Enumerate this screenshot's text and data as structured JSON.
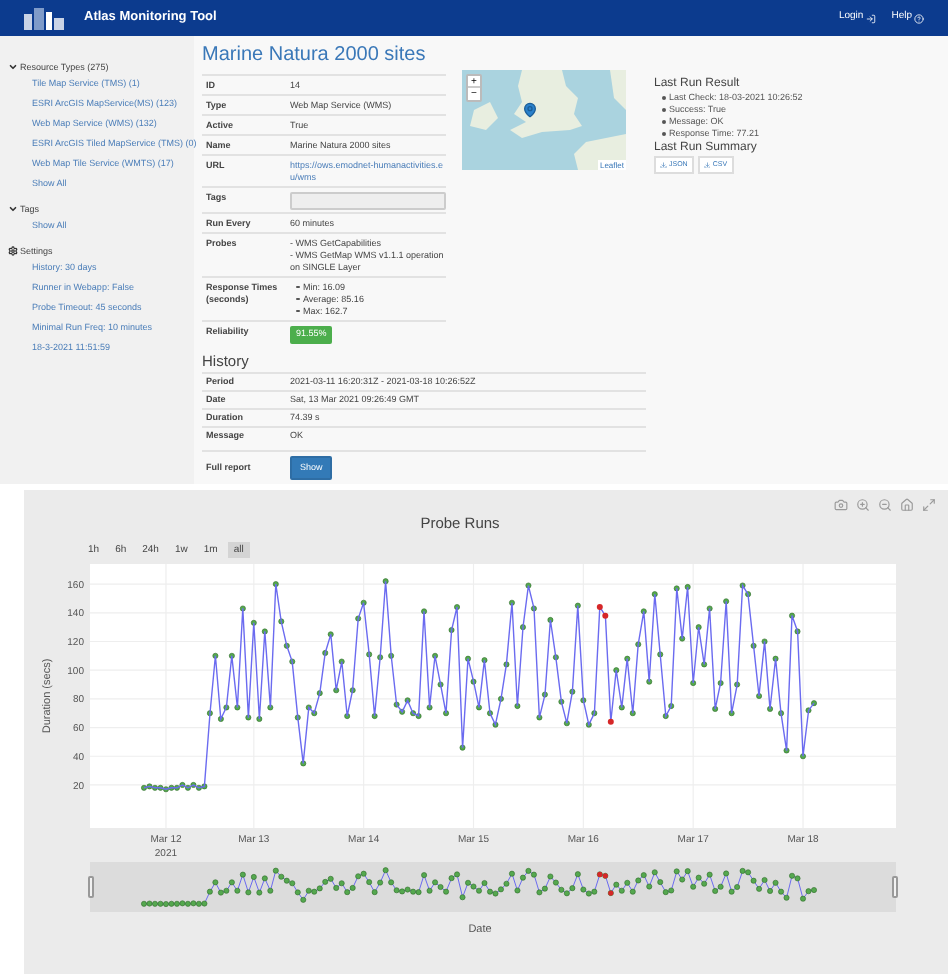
{
  "header": {
    "title": "Atlas Monitoring Tool",
    "links": [
      {
        "label": "Login",
        "kind": "login"
      },
      {
        "label": "Help",
        "kind": "help"
      }
    ]
  },
  "sidebar": {
    "sections": [
      {
        "title": "Resource Types (275)",
        "kind": "tree",
        "expanded": true,
        "items": [
          "Tile Map Service (TMS) (1)",
          "ESRI ArcGIS MapService(MS) (123)",
          "Web Map Service (WMS) (132)",
          "ESRI ArcGIS Tiled MapService (TMS) (0)",
          "Web Map Tile Service (WMTS) (17)",
          "Show All"
        ]
      },
      {
        "title": "Tags",
        "kind": "tree",
        "expanded": true,
        "items": [
          "Show All"
        ]
      },
      {
        "title": "Settings",
        "kind": "settings",
        "items": [
          "History: 30 days",
          "Runner in Webapp: False",
          "Probe Timeout: 45 seconds",
          "Minimal Run Freq: 10 minutes",
          "18-3-2021 11:51:59"
        ]
      }
    ]
  },
  "resource": {
    "title": "Marine Natura 2000 sites",
    "details": [
      {
        "label": "ID",
        "kind": "text",
        "value": "14"
      },
      {
        "label": "Type",
        "kind": "text",
        "value": "Web Map Service (WMS)"
      },
      {
        "label": "Active",
        "kind": "text",
        "value": "True"
      },
      {
        "label": "Name",
        "kind": "text",
        "value": "Marine Natura 2000 sites"
      },
      {
        "label": "URL",
        "kind": "link",
        "value": "https://ows.emodnet-humanactivities.eu/wms"
      },
      {
        "label": "Tags",
        "kind": "field"
      },
      {
        "label": "Run Every",
        "kind": "text",
        "value": "60 minutes"
      },
      {
        "label": "Probes",
        "kind": "lines",
        "lines": [
          "- WMS GetCapabilities",
          "- WMS GetMap WMS v1.1.1 operation on SINGLE Layer"
        ]
      },
      {
        "label": "Response Times (seconds)",
        "kind": "bullets",
        "items": [
          "Min: 16.09",
          "Average: 85.16",
          "Max: 162.7"
        ]
      },
      {
        "label": "Reliability",
        "kind": "badge",
        "value": "91.55%"
      }
    ],
    "history": {
      "title": "History",
      "rows": [
        {
          "label": "Period",
          "value": "2021-03-11 16:20:31Z - 2021-03-18 10:26:52Z"
        },
        {
          "label": "Date",
          "value": "Sat, 13 Mar 2021 09:26:49 GMT"
        },
        {
          "label": "Duration",
          "value": "74.39 s"
        },
        {
          "label": "Message",
          "value": "OK"
        }
      ]
    },
    "full_report": {
      "label": "Full report",
      "button": "Show"
    }
  },
  "map": {
    "zoom_in": "+",
    "zoom_out": "−",
    "attribution": "Leaflet"
  },
  "last_run": {
    "title": "Last Run Result",
    "items": [
      "Last Check: 18-03-2021 10:26:52",
      "Success: True",
      "Message: OK",
      "Response Time: 77.21"
    ],
    "summary_title": "Last Run Summary",
    "downloads": [
      "JSON",
      "CSV"
    ]
  },
  "chart": {
    "range_buttons": [
      {
        "label": "1h",
        "selected": false
      },
      {
        "label": "6h",
        "selected": false
      },
      {
        "label": "24h",
        "selected": false
      },
      {
        "label": "1w",
        "selected": false
      },
      {
        "label": "1m",
        "selected": false
      },
      {
        "label": "all",
        "selected": true
      }
    ],
    "year_label": "2021",
    "range_slider": {
      "level": 1
    },
    "chart_data": {
      "type": "line",
      "title": "Probe Runs",
      "xlabel": "Date",
      "ylabel": "Duration (secs)",
      "categories": [
        null,
        null,
        null,
        null,
        "Mar 12",
        null,
        null,
        null,
        null,
        null,
        null,
        null,
        null,
        null,
        null,
        null,
        null,
        null,
        null,
        null,
        "Mar 13",
        null,
        null,
        null,
        null,
        null,
        null,
        null,
        null,
        null,
        null,
        null,
        null,
        null,
        null,
        null,
        null,
        null,
        null,
        null,
        "Mar 14",
        null,
        null,
        null,
        null,
        null,
        null,
        null,
        null,
        null,
        null,
        null,
        null,
        null,
        null,
        null,
        null,
        null,
        null,
        null,
        "Mar 15",
        null,
        null,
        null,
        null,
        null,
        null,
        null,
        null,
        null,
        null,
        null,
        null,
        null,
        null,
        null,
        null,
        null,
        null,
        null,
        "Mar 16",
        null,
        null,
        null,
        null,
        null,
        null,
        null,
        null,
        null,
        null,
        null,
        null,
        null,
        null,
        null,
        null,
        null,
        null,
        null,
        "Mar 17",
        null,
        null,
        null,
        null,
        null,
        null,
        null,
        null,
        null,
        null,
        null,
        null,
        null,
        null,
        null,
        null,
        null,
        null,
        null,
        "Mar 18",
        null,
        null
      ],
      "series": [
        {
          "type": "line",
          "color": "#6b6bf0",
          "marker": true,
          "values": [
            18,
            19,
            18,
            18,
            17,
            18,
            18,
            20,
            18,
            20,
            18,
            19,
            70,
            110,
            66,
            74,
            110,
            74,
            143,
            67,
            133,
            66,
            127,
            74,
            160,
            134,
            117,
            106,
            67,
            35,
            74,
            70,
            84,
            112,
            125,
            86,
            106,
            68,
            86,
            136,
            147,
            111,
            68,
            109,
            162,
            110,
            76,
            71,
            79,
            70,
            68,
            141,
            74,
            110,
            90,
            70,
            128,
            144,
            46,
            108,
            92,
            74,
            107,
            70,
            62,
            80,
            104,
            147,
            75,
            130,
            159,
            143,
            67,
            83,
            135,
            109,
            78,
            63,
            85,
            145,
            79,
            62,
            70,
            144,
            138,
            64,
            100,
            74,
            108,
            70,
            118,
            141,
            92,
            153,
            111,
            68,
            75,
            157,
            122,
            158,
            91,
            130,
            104,
            143,
            73,
            91,
            148,
            70,
            90,
            159,
            153,
            117,
            82,
            120,
            73,
            108,
            70,
            44,
            138,
            127,
            40,
            72,
            77
          ]
        },
        {
          "type": "scatter",
          "color": "#d62728",
          "marker": true,
          "values": [
            null,
            null,
            null,
            null,
            null,
            null,
            null,
            null,
            null,
            null,
            null,
            null,
            null,
            null,
            null,
            null,
            null,
            null,
            null,
            null,
            null,
            null,
            null,
            null,
            null,
            null,
            null,
            null,
            null,
            null,
            null,
            null,
            null,
            null,
            null,
            null,
            null,
            null,
            null,
            null,
            null,
            null,
            null,
            null,
            null,
            null,
            null,
            null,
            null,
            null,
            null,
            null,
            null,
            null,
            null,
            null,
            null,
            null,
            null,
            null,
            null,
            null,
            null,
            null,
            null,
            null,
            null,
            null,
            null,
            null,
            null,
            null,
            null,
            null,
            null,
            null,
            null,
            null,
            null,
            null,
            null,
            null,
            null,
            144,
            138,
            64,
            null,
            null,
            null,
            null,
            null,
            null,
            null,
            null,
            null,
            null,
            null,
            null,
            null,
            null,
            null,
            null,
            null,
            null,
            null,
            null,
            null,
            null,
            null,
            null,
            null,
            null,
            null,
            null,
            null,
            null,
            null,
            null,
            null,
            null,
            null,
            null,
            null
          ]
        }
      ],
      "grid": true,
      "ylim": [
        -10,
        174
      ],
      "yticks": [
        20,
        40,
        60,
        80,
        100,
        120,
        140,
        160
      ]
    }
  }
}
